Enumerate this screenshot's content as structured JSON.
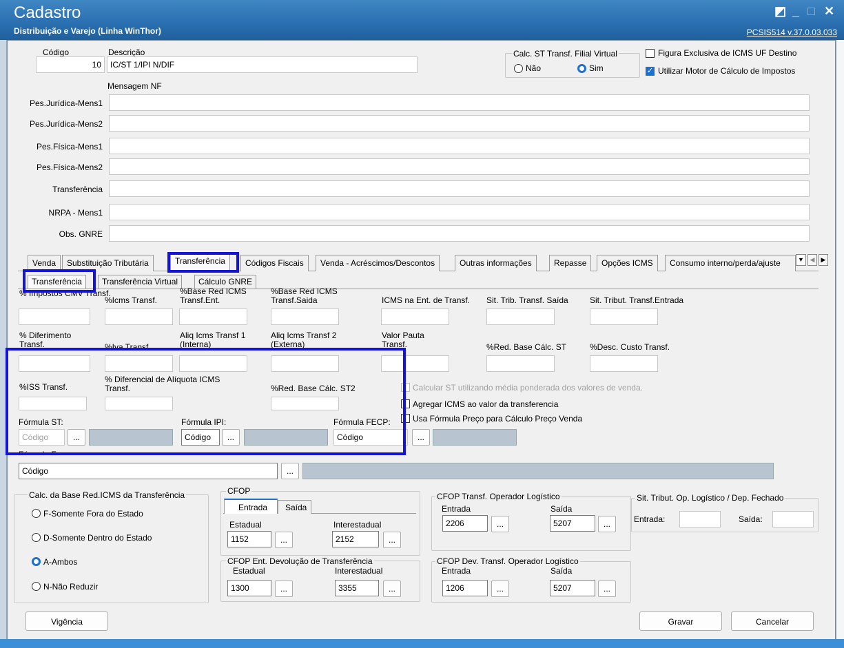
{
  "window": {
    "title": "Cadastro",
    "subtitle": "Distribuição e Varejo (Linha WinThor)",
    "version": "PCSIS514 v.37.0.03.033"
  },
  "header": {
    "codigo_label": "Código",
    "codigo_value": "10",
    "descricao_label": "Descrição",
    "descricao_value": "IC/ST 1/IPI N/DIF",
    "mensagem_nf_label": "Mensagem NF",
    "calc_st_group": "Calc. ST Transf. Filial Virtual",
    "radio_nao": "Não",
    "radio_sim": "Sim",
    "chk_figura": "Figura Exclusiva de ICMS UF Destino",
    "chk_motor": "Utilizar Motor de Cálculo de Impostos"
  },
  "messages": [
    {
      "label": "Pes.Jurídica-Mens1"
    },
    {
      "label": "Pes.Jurídica-Mens2"
    },
    {
      "label": "Pes.Física-Mens1"
    },
    {
      "label": "Pes.Física-Mens2"
    },
    {
      "label": "Transferência"
    },
    {
      "label": "NRPA - Mens1"
    },
    {
      "label": "Obs. GNRE"
    }
  ],
  "tabs": [
    "Venda",
    "Substituição Tributária",
    "Transferência",
    "Códigos Fiscais",
    "Venda - Acréscimos/Descontos",
    "Outras informações",
    "Repasse",
    "Opções ICMS",
    "Consumo interno/perda/ajuste"
  ],
  "subtabs": [
    "Transferência",
    "Transferência Virtual",
    "Cálculo GNRE"
  ],
  "fields": {
    "impostos_cmv": "% Impostos CMV Transf.",
    "icms_transf": "%Icms Transf.",
    "base_red_ent": "%Base Red ICMS Transf.Ent.",
    "base_red_saida": "%Base Red ICMS Transf.Saida",
    "icms_ent": "ICMS na Ent. de Transf.",
    "sit_trib_saida": "Sit. Trib. Transf. Saída",
    "sit_trib_entrada": "Sit. Tribut. Transf.Entrada",
    "diferimento": "% Diferimento Transf.",
    "iva": "%Iva Transf.",
    "aliq1": "Aliq Icms Transf 1 (Interna)",
    "aliq2": "Aliq Icms Transf 2 (Externa)",
    "valor_pauta": "Valor Pauta Transf.",
    "red_base_st": "%Red. Base Cálc. ST",
    "desc_custo": "%Desc. Custo Transf.",
    "iss": "%ISS  Transf.",
    "dif_aliq": "% Diferencial de Alíquota ICMS Transf.",
    "red_base_st2": "%Red. Base Cálc. ST2"
  },
  "checks": {
    "media_ponderada": "Calcular ST utilizando média ponderada dos valores de venda.",
    "agregar": "Agregar ICMS ao valor da transferencia",
    "usa_formula": "Usa Fórmula Preço para Cálculo Preço Venda"
  },
  "formulas": {
    "st_label": "Fórmula ST:",
    "ipi_label": "Fórmula IPI:",
    "fecp_label": "Fórmula FECP:",
    "funcep_label": "Fórmula Funcep:",
    "placeholder": "Código",
    "dots": "..."
  },
  "base_red": {
    "title": "Calc. da Base Red.ICMS da Transferência",
    "options": [
      "F-Somente Fora do Estado",
      "D-Somente Dentro do Estado",
      "A-Ambos",
      "N-Não Reduzir"
    ]
  },
  "cfop": {
    "title": "CFOP",
    "tab_entrada": "Entrada",
    "tab_saida": "Saída",
    "estadual_label": "Estadual",
    "estadual_value": "1152",
    "interestadual_label": "Interestadual",
    "interestadual_value": "2152",
    "dev_title": "CFOP Ent. Devolução de Transferência",
    "dev_estadual_value": "1300",
    "dev_interestadual_value": "3355"
  },
  "cfop_log": {
    "title": "CFOP Transf. Operador Logístico",
    "entrada_label": "Entrada",
    "entrada_value": "2206",
    "saida_label": "Saída",
    "saida_value": "5207",
    "dev_title": "CFOP Dev. Transf. Operador Logístico",
    "dev_entrada_value": "1206",
    "dev_saida_value": "5207"
  },
  "sit_trib_log": {
    "title": "Sit. Tribut. Op. Logístico / Dep. Fechado",
    "entrada_label": "Entrada:",
    "saida_label": "Saída:"
  },
  "buttons": {
    "vigencia": "Vigência",
    "gravar": "Gravar",
    "cancelar": "Cancelar"
  },
  "colors": {
    "title_bar": "#2a6fb0",
    "highlight": "#1414d8",
    "accent": "#1f6fd1"
  }
}
